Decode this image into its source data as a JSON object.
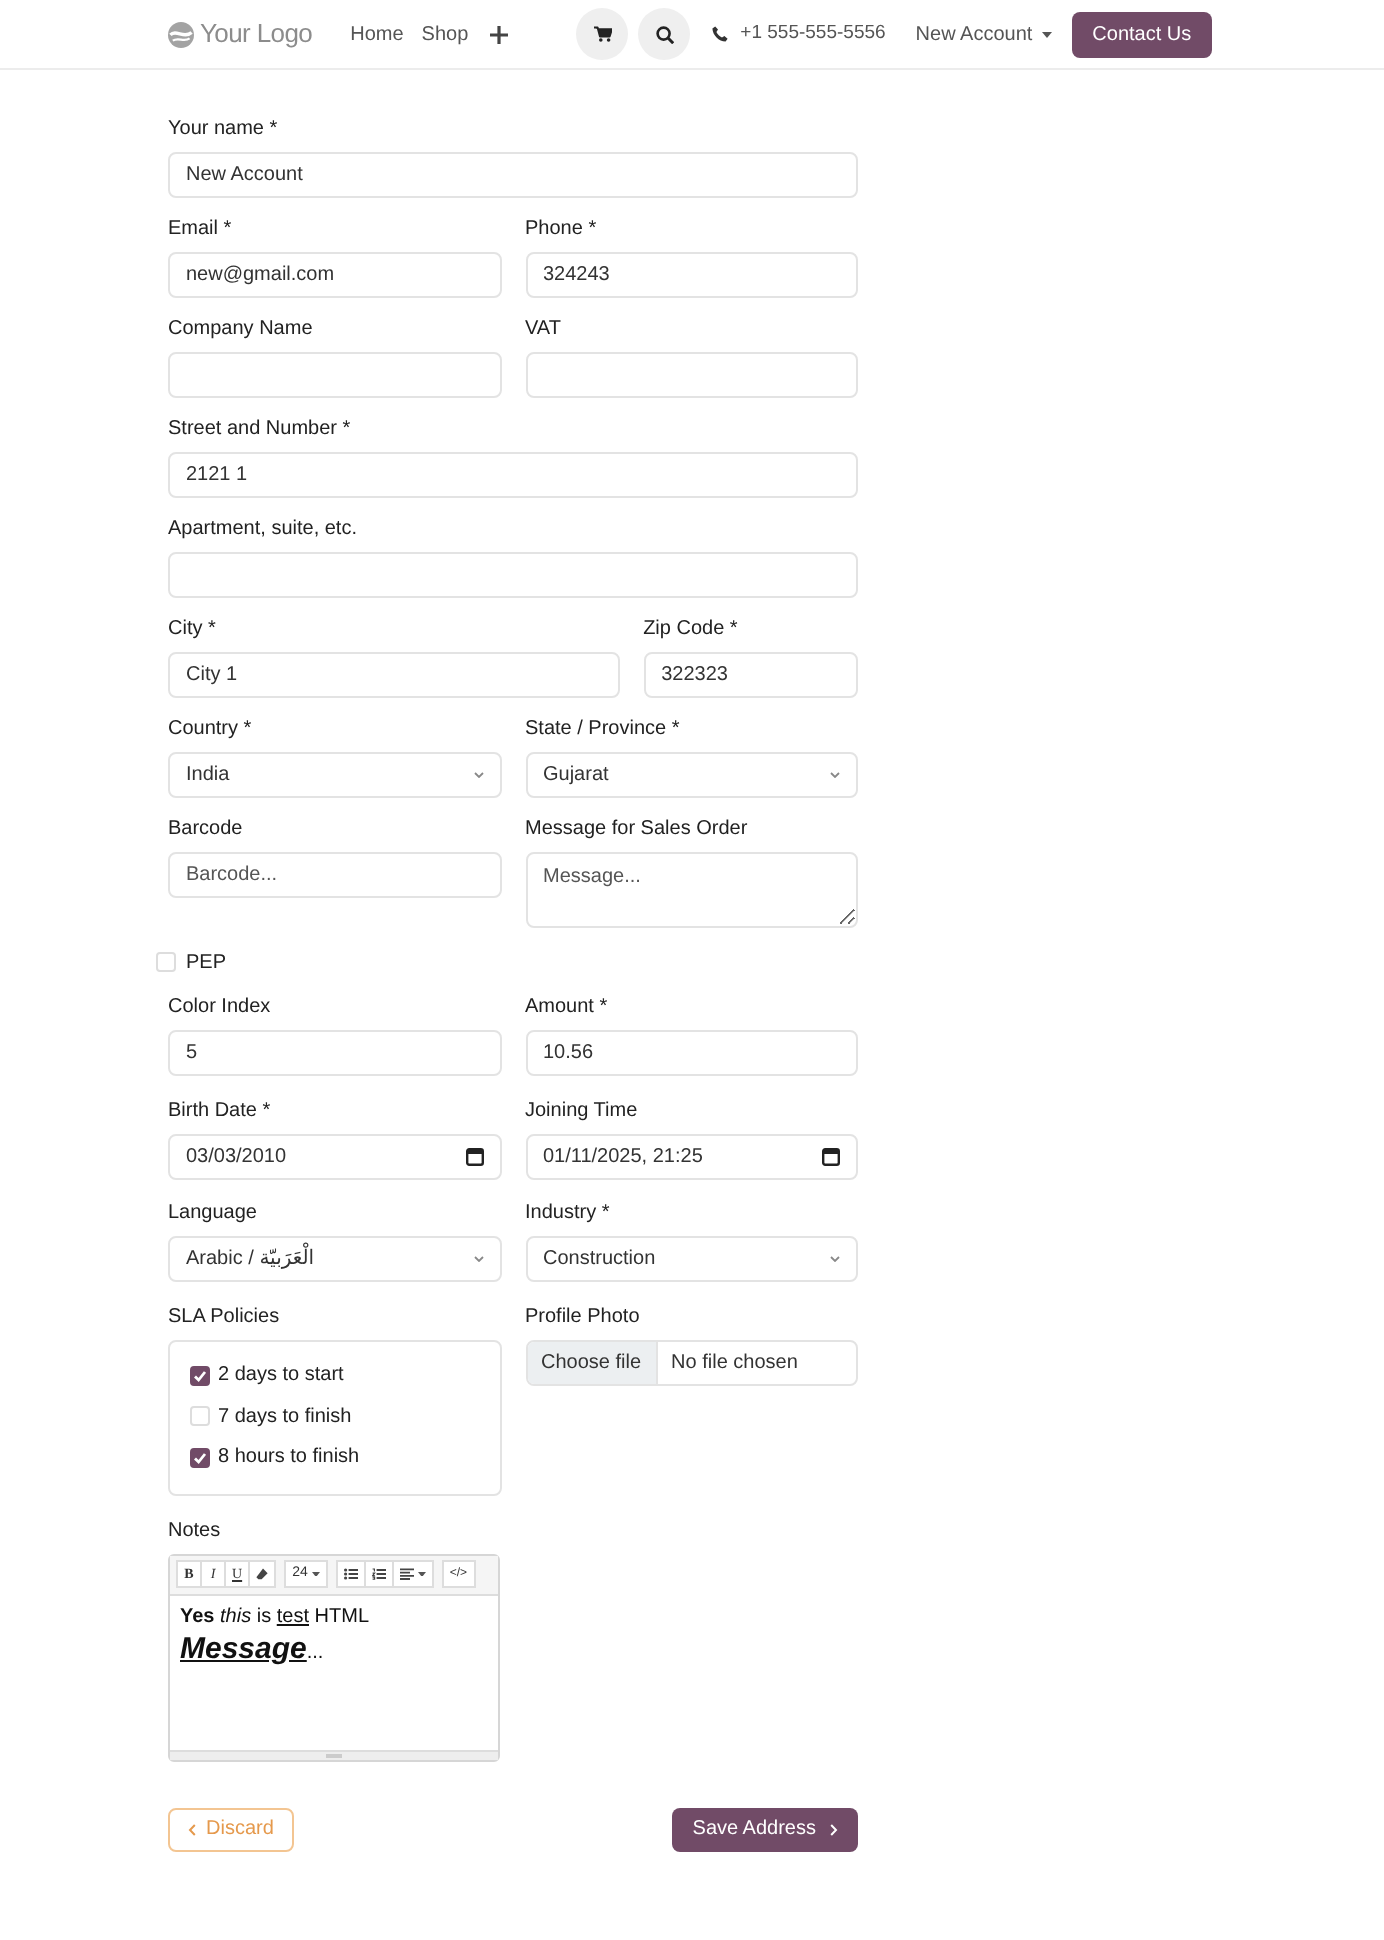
{
  "navbar": {
    "logo_text": "Your Logo",
    "links": [
      {
        "label": "Home"
      },
      {
        "label": "Shop"
      }
    ],
    "phone": "+1 555-555-5556",
    "account": "New Account",
    "cta": "Contact Us"
  },
  "form": {
    "rows": [
      [
        {
          "kind": "text",
          "label": "Your name *",
          "value": "New Account"
        }
      ],
      [
        {
          "kind": "text",
          "label": "Email *",
          "value": "new@gmail.com"
        },
        {
          "kind": "text",
          "label": "Phone *",
          "value": "324243"
        }
      ],
      [
        {
          "kind": "text",
          "label": "Company Name"
        },
        {
          "kind": "text",
          "label": "VAT"
        }
      ],
      [
        {
          "kind": "text",
          "label": "Street and Number *",
          "value": "2121 1"
        }
      ],
      [
        {
          "kind": "text",
          "label": "Apartment, suite, etc."
        }
      ],
      [
        {
          "kind": "text",
          "label": "City *",
          "value": "City 1"
        },
        {
          "kind": "text",
          "label": "Zip Code *",
          "value": "322323"
        }
      ],
      [
        {
          "kind": "select",
          "label": "Country *",
          "value": "India"
        },
        {
          "kind": "select",
          "label": "State / Province *",
          "value": "Gujarat"
        }
      ],
      [
        {
          "kind": "text",
          "label": "Barcode",
          "placeholder": "Barcode..."
        },
        {
          "kind": "textarea",
          "label": "Message for Sales Order",
          "placeholder": "Message..."
        }
      ],
      [
        {
          "kind": "checkbox",
          "label": "PEP",
          "checked": false
        }
      ],
      [
        {
          "kind": "text",
          "label": "Color Index",
          "value": "5"
        },
        {
          "kind": "text",
          "label": "Amount *",
          "value": "10.56"
        }
      ],
      [
        {
          "kind": "date",
          "label": "Birth Date *",
          "value": "03/03/2010"
        },
        {
          "kind": "date",
          "label": "Joining Time",
          "value": "01/11/2025, 21:25"
        }
      ],
      [
        {
          "kind": "select",
          "label": "Language",
          "value": "Arabic / الْعَرَبيّة"
        },
        {
          "kind": "select",
          "label": "Industry *",
          "value": "Construction"
        }
      ],
      [
        {
          "kind": "checkgroup",
          "label": "SLA Policies",
          "options": [
            {
              "label": "2 days to start",
              "checked": true
            },
            {
              "label": "7 days to finish",
              "checked": false
            },
            {
              "label": "8 hours to finish",
              "checked": true
            }
          ]
        },
        {
          "kind": "file",
          "label": "Profile Photo",
          "button": "Choose file",
          "status": "No file chosen"
        }
      ],
      [
        {
          "kind": "editor",
          "label": "Notes",
          "toolbar": [
            [
              {
                "kind": "bold",
                "label": "B"
              },
              {
                "kind": "italic",
                "label": "I"
              },
              {
                "kind": "underline",
                "label": "U"
              },
              {
                "kind": "eraser"
              }
            ],
            [
              {
                "kind": "font-size",
                "label": "24"
              }
            ],
            [
              {
                "kind": "bullets"
              },
              {
                "kind": "numbers"
              },
              {
                "kind": "align"
              }
            ],
            [
              {
                "kind": "code",
                "label": "</>"
              }
            ]
          ],
          "lines": [
            {
              "segments": [
                {
                  "text": "Yes",
                  "bold": true
                },
                {
                  "text": " this",
                  "italic": true
                },
                {
                  "text": " is "
                },
                {
                  "text": "test",
                  "underline": true
                },
                {
                  "text": " HTML"
                }
              ]
            },
            {
              "segments": [
                {
                  "text": "Message",
                  "large": true,
                  "bold": true,
                  "italic": true,
                  "underline": true
                },
                {
                  "text": "..."
                }
              ]
            }
          ]
        }
      ]
    ]
  },
  "actions": [
    {
      "kind": "discard",
      "label": "Discard"
    },
    {
      "kind": "save",
      "label": "Save Address"
    }
  ]
}
